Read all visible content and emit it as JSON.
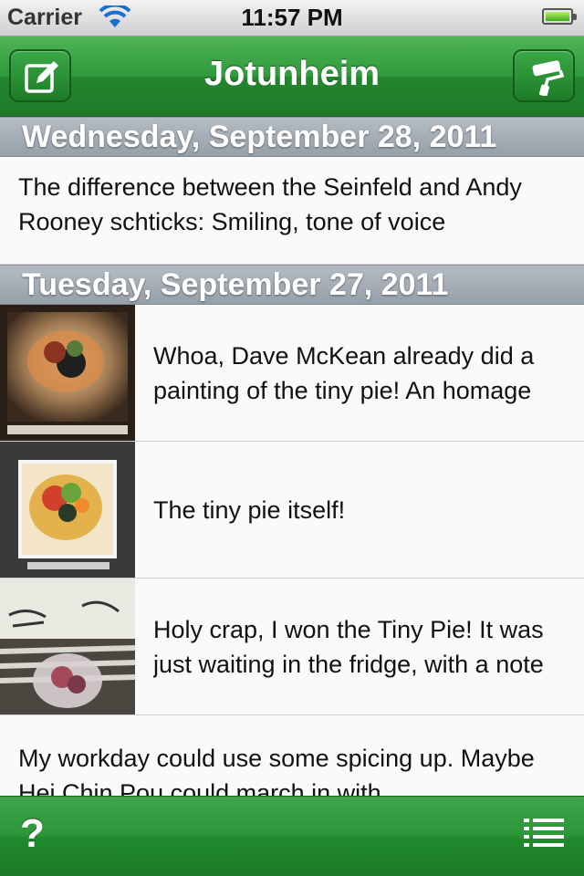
{
  "status_bar": {
    "carrier": "Carrier",
    "time": "11:57 PM"
  },
  "nav": {
    "title": "Jotunheim",
    "left_icon": "compose-icon",
    "right_icon": "paint-roller-icon"
  },
  "sections": [
    {
      "header": "Wednesday, September 28, 2011",
      "rows": [
        {
          "text": "The difference between the Seinfeld and Andy Rooney schticks: Smiling, tone of voice"
        }
      ]
    },
    {
      "header": "Tuesday, September 27, 2011",
      "rows": [
        {
          "text": "Whoa, Dave McKean already did a painting of the tiny pie! An homage"
        },
        {
          "text": "The tiny pie itself!"
        },
        {
          "text": "Holy crap, I won the Tiny Pie! It was just waiting in the fridge, with a note"
        },
        {
          "text": "My workday could use some spicing up. Maybe Hei Chin Pou could march in with"
        }
      ]
    }
  ],
  "tab_bar": {
    "help_label": "?",
    "list_icon": "list-icon"
  },
  "colors": {
    "nav_green": "#2f9a3b",
    "section_gray": "#a2abb3"
  }
}
